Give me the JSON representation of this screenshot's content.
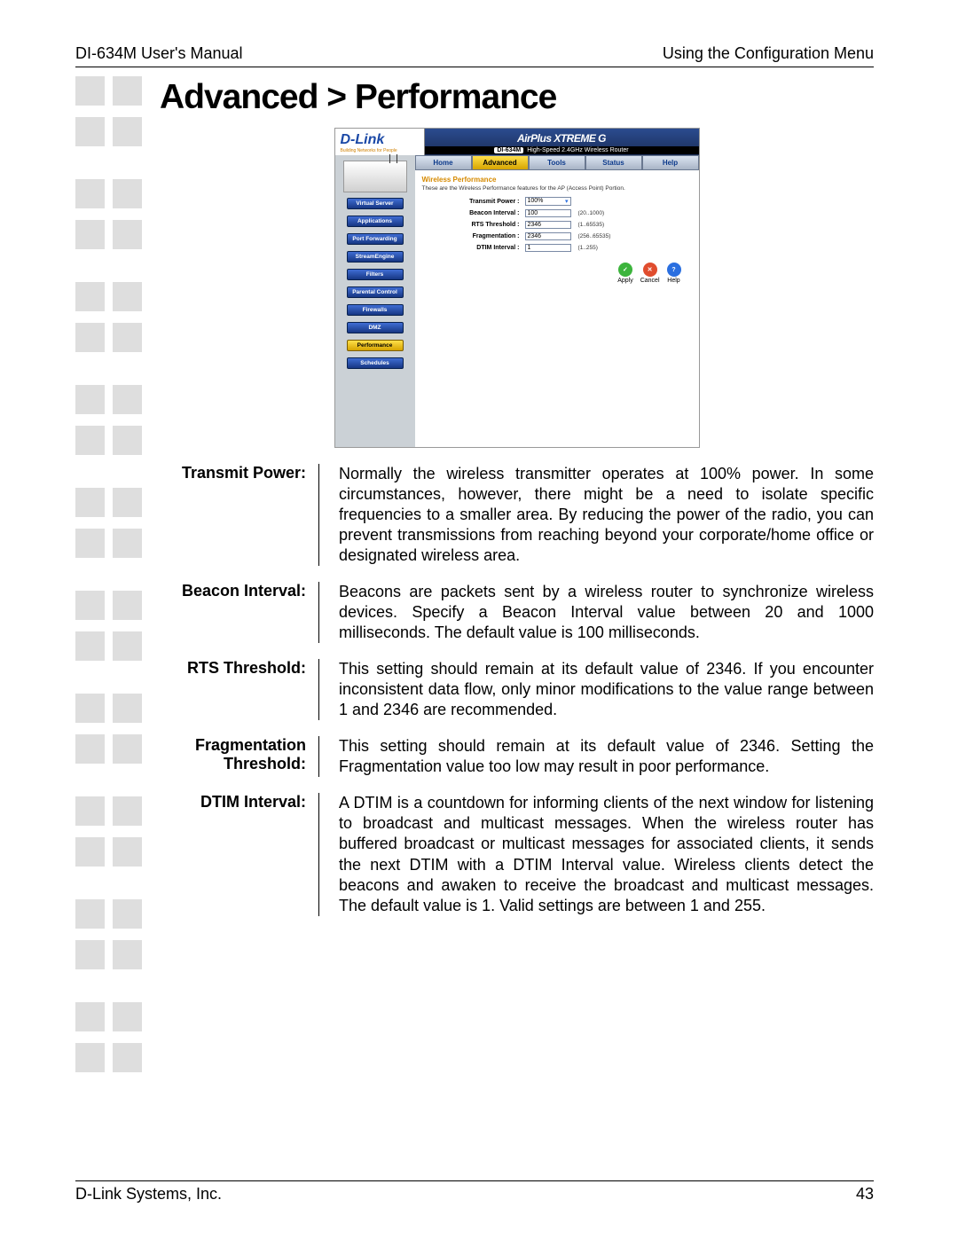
{
  "header": {
    "left": "DI-634M User's Manual",
    "right": "Using the Configuration Menu"
  },
  "title": "Advanced > Performance",
  "router": {
    "logo": "D-Link",
    "logo_sub": "Building Networks for People",
    "brand_line": "AirPlus XTREME G",
    "model_line_pill": "DI-634M",
    "model_line_text": "High-Speed 2.4GHz Wireless Router",
    "tabs": {
      "home": "Home",
      "advanced": "Advanced",
      "tools": "Tools",
      "status": "Status",
      "help": "Help"
    },
    "side": {
      "virtual_server": "Virtual Server",
      "applications": "Applications",
      "port_forwarding": "Port Forwarding",
      "stream_engine": "StreamEngine",
      "filters": "Filters",
      "parental_control": "Parental Control",
      "firewalls": "Firewalls",
      "dmz": "DMZ",
      "performance": "Performance",
      "schedules": "Schedules"
    },
    "pane": {
      "heading": "Wireless Performance",
      "subtext": "These are the Wireless Performance features for the AP (Access Point) Portion.",
      "rows": {
        "tx_label": "Transmit Power :",
        "tx_value": "100%",
        "beacon_label": "Beacon Interval :",
        "beacon_value": "100",
        "beacon_hint": "(20..1000)",
        "rts_label": "RTS Threshold :",
        "rts_value": "2346",
        "rts_hint": "(1..65535)",
        "frag_label": "Fragmentation :",
        "frag_value": "2346",
        "frag_hint": "(256..65535)",
        "dtim_label": "DTIM Interval :",
        "dtim_value": "1",
        "dtim_hint": "(1..255)"
      },
      "actions": {
        "apply": "Apply",
        "cancel": "Cancel",
        "help": "Help"
      }
    }
  },
  "defs": [
    {
      "label": "Transmit Power:",
      "text": "Normally the wireless transmitter operates at 100% power. In some circumstances, however, there might be a need to isolate specific frequencies to a smaller area. By reducing the power of the radio, you can prevent transmissions from reaching beyond your corporate/home office or designated wireless area."
    },
    {
      "label": "Beacon Interval:",
      "text": "Beacons are packets sent by a wireless router to synchronize wireless devices. Specify a Beacon Interval value between 20 and 1000 milliseconds. The default value is 100 milliseconds."
    },
    {
      "label": "RTS Threshold:",
      "text": "This setting should remain at its default value of 2346. If you encounter inconsistent data flow, only minor modifications to the value range between 1 and 2346 are recommended."
    },
    {
      "label": "Fragmentation Threshold:",
      "text": "This setting should remain at its default value of 2346. Setting the Fragmentation value too low may result in poor performance."
    },
    {
      "label": "DTIM Interval:",
      "text": "A DTIM is a countdown for informing clients of the next window for listening to broadcast and multicast messages. When the wireless router has buffered broadcast or multicast messages for associated clients, it sends the next DTIM with a DTIM Interval value. Wireless clients detect the beacons and awaken to receive the broadcast and multicast messages. The default value is 1. Valid settings are between 1 and 255."
    }
  ],
  "footer": {
    "left": "D-Link Systems, Inc.",
    "right": "43"
  }
}
